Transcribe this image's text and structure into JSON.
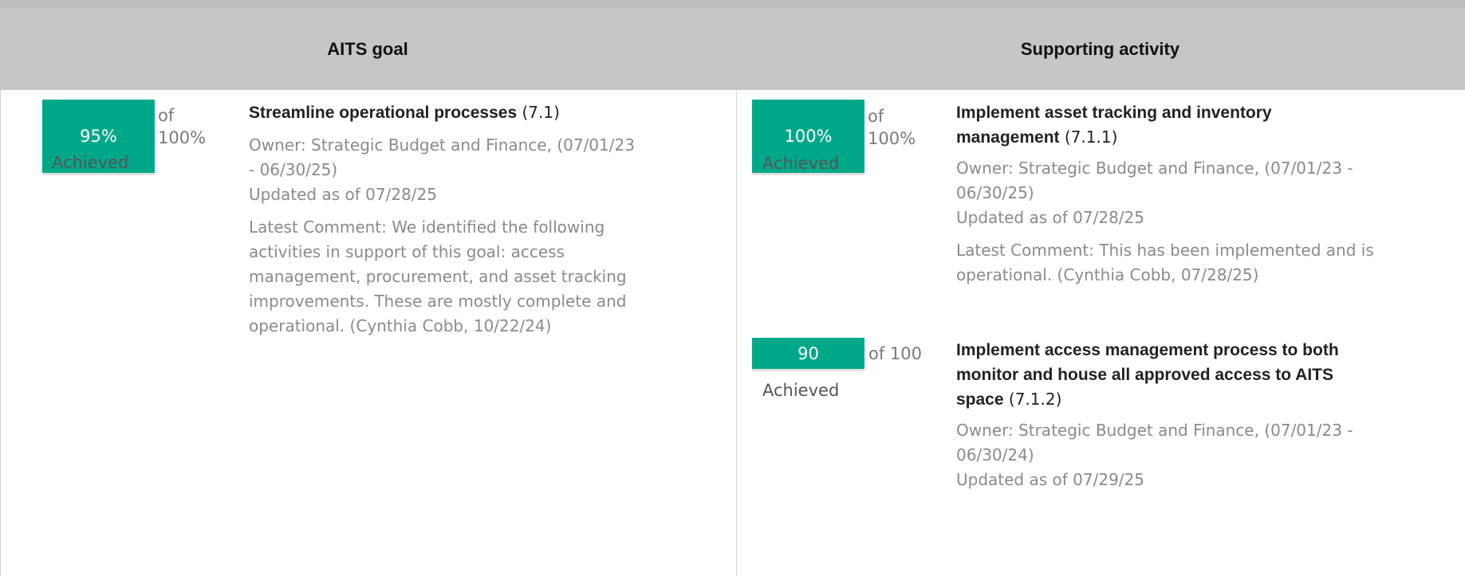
{
  "header": {
    "left_title": "AITS goal",
    "right_title": "Supporting activity"
  },
  "goal": {
    "gauge_value": "95%",
    "gauge_of_line1": "of",
    "gauge_of_line2": "100%",
    "gauge_achieved": "Achieved",
    "title": "Streamline operational processes",
    "code": "(7.1)",
    "owner_line1": "Owner: Strategic Budget and Finance, (07/01/23",
    "owner_line2": "- 06/30/25)",
    "updated": "Updated as of 07/28/25",
    "comment_line1": "Latest Comment: We identified the following",
    "comment_line2": "activities in support of this goal: access",
    "comment_line3": "management, procurement, and asset tracking",
    "comment_line4": "improvements. These are mostly complete and",
    "comment_line5": "operational. (Cynthia Cobb, 10/22/24)",
    "progress_fraction": 0.95
  },
  "activities": [
    {
      "gauge_value": "100%",
      "gauge_of_line1": "of",
      "gauge_of_line2": "100%",
      "gauge_achieved": "Achieved",
      "title_line1": "Implement asset tracking and inventory",
      "title_line2": "management",
      "code": "(7.1.1)",
      "owner_line1": "Owner: Strategic Budget and Finance, (07/01/23 -",
      "owner_line2": "06/30/25)",
      "updated": "Updated as of 07/28/25",
      "comment_line1": "Latest Comment: This has been implemented and is",
      "comment_line2": "operational. (Cynthia Cobb, 07/28/25)",
      "progress_fraction": 1.0
    },
    {
      "gauge_value": "90",
      "gauge_of": "of 100",
      "gauge_achieved": "Achieved",
      "title_line1": "Implement access management process to both",
      "title_line2": "monitor and house all approved access to AITS",
      "title_line3": "space",
      "code": "(7.1.2)",
      "owner_line1": "Owner: Strategic Budget and Finance, (07/01/23 -",
      "owner_line2": "06/30/24)",
      "updated": "Updated as of 07/29/25",
      "progress_fraction": 0.9
    }
  ],
  "colors": {
    "gauge_fill": "#00a88a",
    "header_bg": "#c6c6c6",
    "muted_text": "#8a8a8a"
  }
}
